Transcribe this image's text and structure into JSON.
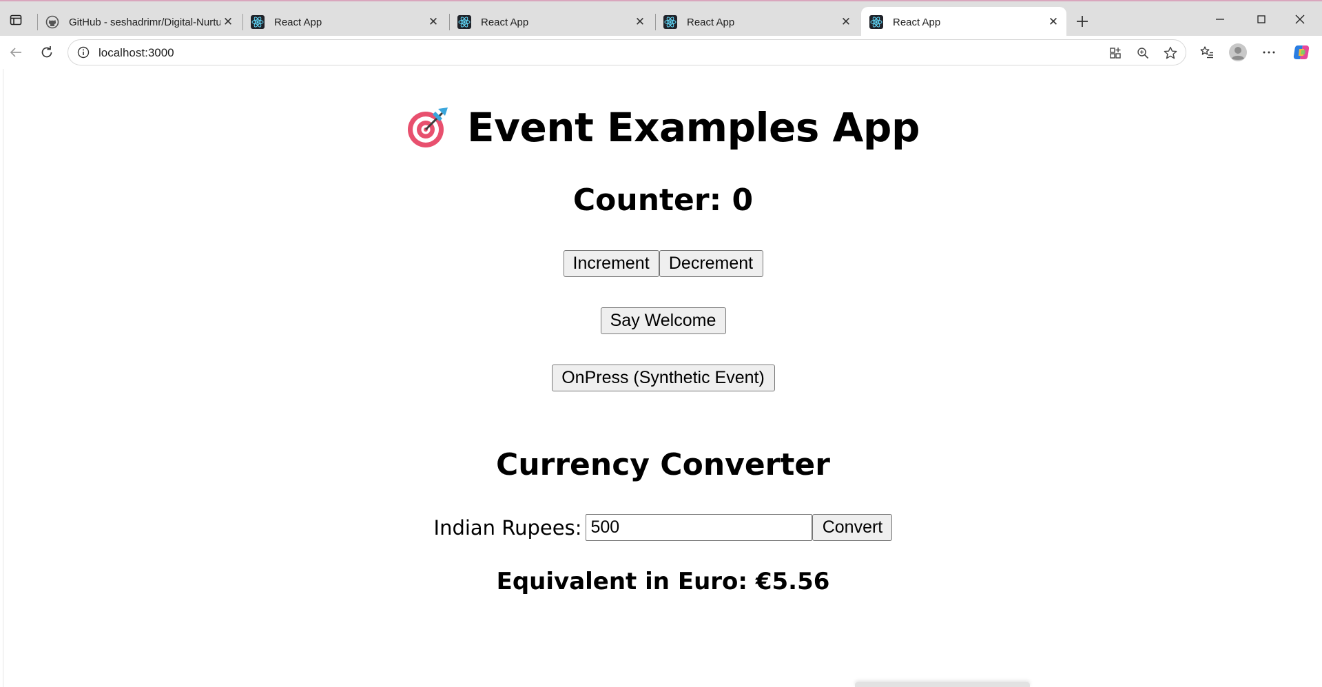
{
  "browser": {
    "tabs": [
      {
        "title": "GitHub - seshadrimr/Digital-Nurtu",
        "favicon": "github-icon",
        "active": false
      },
      {
        "title": "React App",
        "favicon": "react-icon",
        "active": false
      },
      {
        "title": "React App",
        "favicon": "react-icon",
        "active": false
      },
      {
        "title": "React App",
        "favicon": "react-icon",
        "active": false
      },
      {
        "title": "React App",
        "favicon": "react-icon",
        "active": true
      }
    ],
    "url": "localhost:3000",
    "colors": {
      "react_blue": "#61dafb",
      "tab_bg": "#dfdfdf",
      "active_tab_bg": "#ffffff"
    }
  },
  "app": {
    "title": "Event Examples App",
    "title_emoji_icon": "direct-hit-target-icon",
    "counter_text": "Counter: 0",
    "increment_label": "Increment",
    "decrement_label": "Decrement",
    "welcome_label": "Say Welcome",
    "onpress_label": "OnPress (Synthetic Event)",
    "currency": {
      "title": "Currency Converter",
      "input_label": "Indian Rupees:",
      "input_value": "500",
      "convert_label": "Convert",
      "result_text": "Equivalent in Euro: €5.56"
    }
  }
}
